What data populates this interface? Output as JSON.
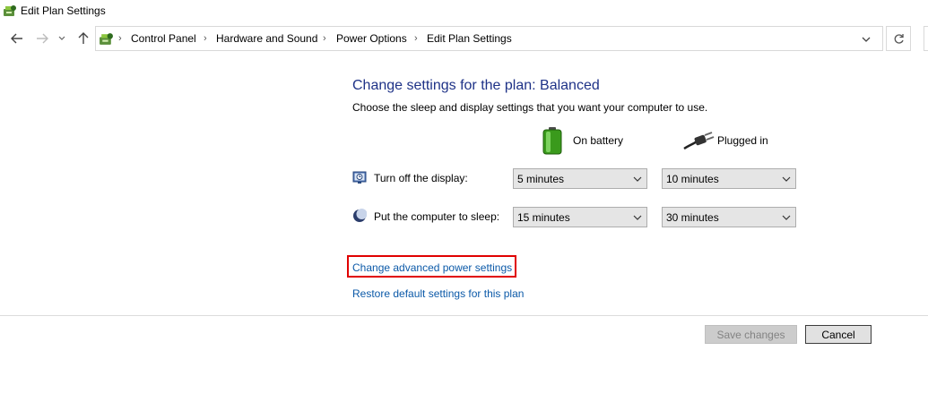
{
  "window": {
    "title": "Edit Plan Settings"
  },
  "address_bar": {
    "breadcrumbs": [
      "Control Panel",
      "Hardware and Sound",
      "Power Options",
      "Edit Plan Settings"
    ]
  },
  "main": {
    "heading": "Change settings for the plan: Balanced",
    "description": "Choose the sleep and display settings that you want your computer to use.",
    "columns": {
      "battery": "On battery",
      "plugged": "Plugged in"
    },
    "rows": [
      {
        "label": "Turn off the display:",
        "battery": "5 minutes",
        "plugged": "10 minutes",
        "icon": "display-clock-icon"
      },
      {
        "label": "Put the computer to sleep:",
        "battery": "15 minutes",
        "plugged": "30 minutes",
        "icon": "moon-icon"
      }
    ],
    "links": {
      "advanced": "Change advanced power settings",
      "restore": "Restore default settings for this plan"
    }
  },
  "footer": {
    "save_label": "Save changes",
    "cancel_label": "Cancel"
  },
  "colors": {
    "heading": "#1e3287",
    "link": "#0b59a8",
    "highlight": "#e00000"
  }
}
